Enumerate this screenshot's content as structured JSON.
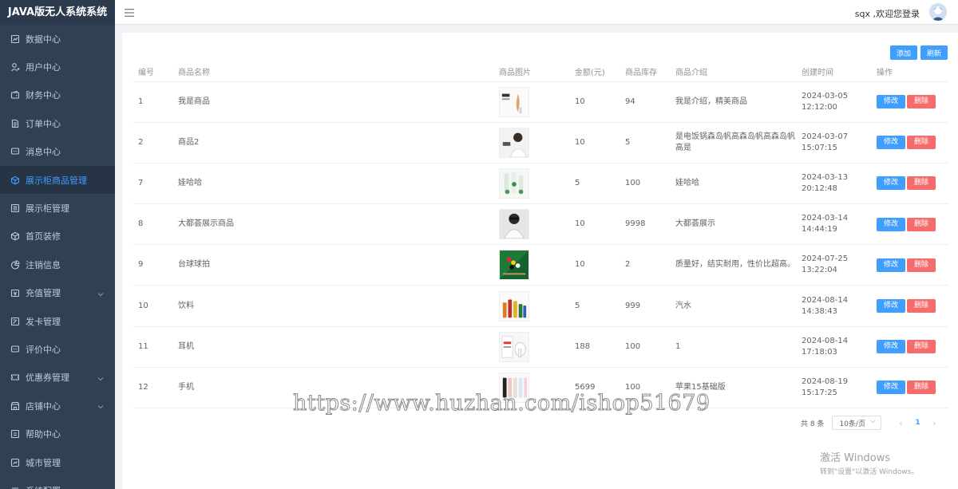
{
  "app": {
    "brand": "JAVA版无人系统系统"
  },
  "sidebar": {
    "items": [
      {
        "label": "数据中心",
        "icon": "dashboard-icon",
        "has_arrow": false,
        "active": false
      },
      {
        "label": "用户中心",
        "icon": "user-icon",
        "has_arrow": false,
        "active": false
      },
      {
        "label": "财务中心",
        "icon": "wallet-icon",
        "has_arrow": false,
        "active": false
      },
      {
        "label": "订单中心",
        "icon": "document-icon",
        "has_arrow": false,
        "active": false
      },
      {
        "label": "消息中心",
        "icon": "message-icon",
        "has_arrow": false,
        "active": false
      },
      {
        "label": "展示柜商品管理",
        "icon": "cube-icon",
        "has_arrow": false,
        "active": true
      },
      {
        "label": "展示柜管理",
        "icon": "list-icon",
        "has_arrow": false,
        "active": false
      },
      {
        "label": "首页装修",
        "icon": "cube-icon",
        "has_arrow": false,
        "active": false
      },
      {
        "label": "注销信息",
        "icon": "pie-icon",
        "has_arrow": false,
        "active": false
      },
      {
        "label": "充值管理",
        "icon": "recharge-icon",
        "has_arrow": true,
        "active": false
      },
      {
        "label": "发卡管理",
        "icon": "edit-icon",
        "has_arrow": false,
        "active": false
      },
      {
        "label": "评价中心",
        "icon": "message-icon",
        "has_arrow": false,
        "active": false
      },
      {
        "label": "优惠券管理",
        "icon": "coupon-icon",
        "has_arrow": true,
        "active": false
      },
      {
        "label": "店铺中心",
        "icon": "shop-icon",
        "has_arrow": true,
        "active": false
      },
      {
        "label": "帮助中心",
        "icon": "help-icon",
        "has_arrow": false,
        "active": false
      },
      {
        "label": "城市管理",
        "icon": "location-icon",
        "has_arrow": false,
        "active": false
      },
      {
        "label": "系统配置",
        "icon": "settings-icon",
        "has_arrow": false,
        "active": false
      }
    ]
  },
  "header": {
    "user_text": "sqx ,欢迎您登录"
  },
  "toolbar": {
    "add_label": "添加",
    "refresh_label": "刷新"
  },
  "table": {
    "columns": [
      "编号",
      "商品名称",
      "商品图片",
      "金额(元)",
      "商品库存",
      "商品介绍",
      "创建时间",
      "操作"
    ],
    "edit_label": "修改",
    "delete_label": "删除",
    "rows": [
      {
        "id": "1",
        "name": "我是商品",
        "price": "10",
        "stock": "94",
        "intro": "我是介绍，精美商品",
        "created": "2024-03-05 12:12:00"
      },
      {
        "id": "2",
        "name": "商品2",
        "price": "10",
        "stock": "5",
        "intro": "是电饭锅森岛帆高森岛帆高森岛帆高是",
        "created": "2024-03-07 15:07:15"
      },
      {
        "id": "7",
        "name": "娃哈哈",
        "price": "5",
        "stock": "100",
        "intro": "娃哈哈",
        "created": "2024-03-13 20:12:48"
      },
      {
        "id": "8",
        "name": "大都荟展示商品",
        "price": "10",
        "stock": "9998",
        "intro": "大都荟展示",
        "created": "2024-03-14 14:44:19"
      },
      {
        "id": "9",
        "name": "台球球拍",
        "price": "10",
        "stock": "2",
        "intro": "质量好，结实耐用，性价比超高。",
        "created": "2024-07-25 13:22:04"
      },
      {
        "id": "10",
        "name": "饮料",
        "price": "5",
        "stock": "999",
        "intro": "汽水",
        "created": "2024-08-14 14:38:43"
      },
      {
        "id": "11",
        "name": "耳机",
        "price": "188",
        "stock": "100",
        "intro": "1",
        "created": "2024-08-14 17:18:03"
      },
      {
        "id": "12",
        "name": "手机",
        "price": "5699",
        "stock": "100",
        "intro": "苹果15基础版",
        "created": "2024-08-19 15:17:25"
      }
    ]
  },
  "pagination": {
    "total_text": "共 8 条",
    "page_size": "10条/页",
    "current_page": "1"
  },
  "overlay": {
    "watermark": "https://www.huzhan.com/ishop51679",
    "windows_line1": "激活 Windows",
    "windows_line2": "转到\"设置\"以激活 Windows。"
  },
  "colors": {
    "sidebar_bg": "#304156",
    "primary": "#409eff",
    "danger": "#f56c6c"
  }
}
